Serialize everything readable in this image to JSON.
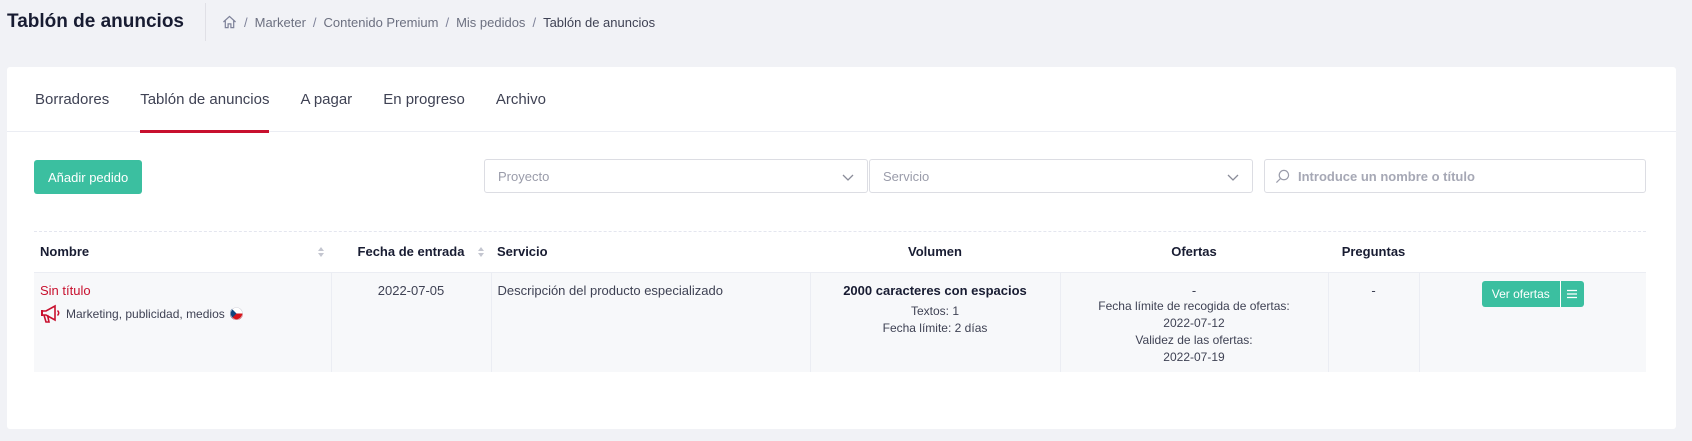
{
  "header": {
    "title": "Tablón de anuncios",
    "breadcrumb": [
      "Marketer",
      "Contenido Premium",
      "Mis pedidos",
      "Tablón de anuncios"
    ]
  },
  "tabs": [
    {
      "label": "Borradores",
      "active": false
    },
    {
      "label": "Tablón de anuncios",
      "active": true
    },
    {
      "label": "A pagar",
      "active": false
    },
    {
      "label": "En progreso",
      "active": false
    },
    {
      "label": "Archivo",
      "active": false
    }
  ],
  "toolbar": {
    "add_label": "Añadir pedido",
    "project_placeholder": "Proyecto",
    "service_placeholder": "Servicio",
    "search_placeholder": "Introduce un nombre o título"
  },
  "table": {
    "headers": {
      "name": "Nombre",
      "date": "Fecha de entrada",
      "service": "Servicio",
      "volume": "Volumen",
      "offers": "Ofertas",
      "questions": "Preguntas"
    },
    "rows": [
      {
        "name": "Sin título",
        "category": "Marketing, publicidad, medios",
        "date": "2022-07-05",
        "service": "Descripción del producto especializado",
        "volume_main": "2000 caracteres con espacios",
        "texts_label": "Textos:",
        "texts_value": "1",
        "deadline_label": "Fecha límite:",
        "deadline_value": "2 días",
        "offers_dash": "-",
        "offers_deadline_label": "Fecha límite de recogida de ofertas:",
        "offers_deadline_value": "2022-07-12",
        "offers_validity_label": "Validez de las ofertas:",
        "offers_validity_value": "2022-07-19",
        "questions": "-",
        "view_offers_label": "Ver ofertas"
      }
    ]
  },
  "colors": {
    "accent": "#3bbfa0",
    "brand_red": "#c8102e"
  },
  "icons": [
    "home-icon",
    "chevron-down-icon",
    "search-icon",
    "sort-icon",
    "megaphone-icon",
    "czech-flag-icon",
    "menu-icon"
  ]
}
